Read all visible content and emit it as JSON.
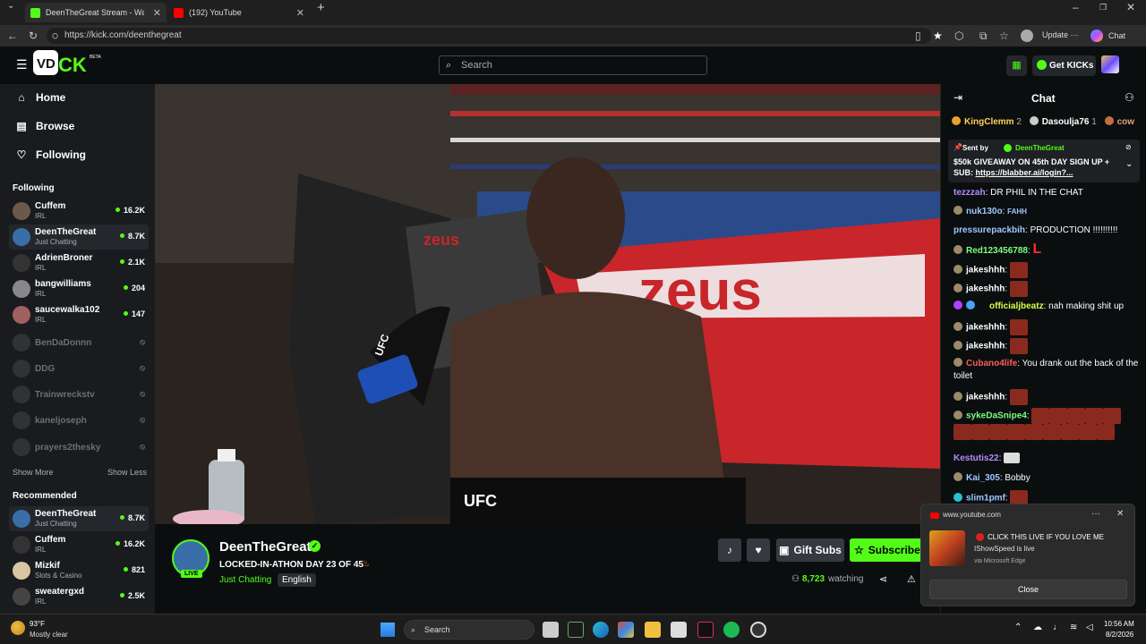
{
  "browser": {
    "tabs": [
      {
        "title": "DeenTheGreat Stream - Watc",
        "active": true
      },
      {
        "title": "(192) YouTube",
        "active": false
      }
    ],
    "url": "https://kick.com/deenthegreat",
    "update_label": "Update",
    "chat_label": "Chat"
  },
  "topnav": {
    "search_placeholder": "Search",
    "get_kicks_label": "Get KICKs"
  },
  "sidebar": {
    "nav": [
      {
        "label": "Home",
        "icon": "home-icon"
      },
      {
        "label": "Browse",
        "icon": "browse-icon"
      },
      {
        "label": "Following",
        "icon": "heart-icon"
      }
    ],
    "following_heading": "Following",
    "following": [
      {
        "name": "Cuffem",
        "category": "IRL",
        "viewers": "16.2K"
      },
      {
        "name": "DeenTheGreat",
        "category": "Just Chatting",
        "viewers": "8.7K"
      },
      {
        "name": "AdrienBroner",
        "category": "IRL",
        "viewers": "2.1K"
      },
      {
        "name": "bangwilliams",
        "category": "IRL",
        "viewers": "204"
      },
      {
        "name": "saucewalka102",
        "category": "IRL",
        "viewers": "147"
      }
    ],
    "offline": [
      "BenDaDonnn",
      "DDG",
      "Trainwreckstv",
      "kaneljoseph",
      "prayers2thesky"
    ],
    "show_more": "Show More",
    "show_less": "Show Less",
    "recommended_heading": "Recommended",
    "recommended": [
      {
        "name": "DeenTheGreat",
        "category": "Just Chatting",
        "viewers": "8.7K"
      },
      {
        "name": "Cuffem",
        "category": "IRL",
        "viewers": "16.2K"
      },
      {
        "name": "Mizkif",
        "category": "Slots & Casino",
        "viewers": "821"
      },
      {
        "name": "sweatergxd",
        "category": "IRL",
        "viewers": "2.5K"
      }
    ]
  },
  "stream": {
    "streamer": "DeenTheGreat",
    "live_badge": "LIVE",
    "title": "LOCKED-IN-ATHON DAY 23 OF 45",
    "category": "Just Chatting",
    "language": "English",
    "gift_subs": "Gift Subs",
    "subscribe": "Subscribe",
    "watching_count": "8,723",
    "watching_label": "watching",
    "video_text": {
      "ring_brand": "zeus",
      "shorts_brand": "UFC",
      "glove_brand": "UFC"
    }
  },
  "chat": {
    "title": "Chat",
    "leaders": [
      {
        "name": "KingClemm",
        "count": "2"
      },
      {
        "name": "Dasoulja76",
        "count": "1"
      },
      {
        "name": "cow",
        "count": ""
      }
    ],
    "pinned": {
      "sent_by_label": "Sent by",
      "sender": "DeenTheGreat",
      "text": "$50k GIVEAWAY ON 45th DAY SIGN UP + SUB:",
      "link": "https://blabber.ai/login?..."
    },
    "messages": [
      {
        "user": "tezzzah",
        "text": "DR PHIL IN THE CHAT",
        "color": "#b48cff"
      },
      {
        "user": "nuk130o",
        "text": "FAHH",
        "color": "#9ec8ff"
      },
      {
        "user": "pressurepackbih",
        "text": "PRODUCTION !!!!!!!!!!",
        "color": "#9ec8ff"
      },
      {
        "user": "Red123456788",
        "text": "L",
        "color": "#7cff7c"
      },
      {
        "user": "jakeshhh",
        "text": "",
        "color": "#ffffff"
      },
      {
        "user": "jakeshhh",
        "text": "",
        "color": "#ffffff"
      },
      {
        "user": "officialjbeatz",
        "text": "nah making shit up",
        "color": "#d6ff4a"
      },
      {
        "user": "jakeshhh",
        "text": "",
        "color": "#ffffff"
      },
      {
        "user": "jakeshhh",
        "text": "",
        "color": "#ffffff"
      },
      {
        "user": "Cubano4life",
        "text": "You drank out the back of the toilet",
        "color": "#ff5a5a"
      },
      {
        "user": "jakeshhh",
        "text": "",
        "color": "#ffffff"
      },
      {
        "user": "sykeDaSnipe4",
        "text": "",
        "color": "#7cff7c"
      },
      {
        "user": "Kestutis22",
        "text": "",
        "color": "#b48cff"
      },
      {
        "user": "Kai_305",
        "text": "Bobby",
        "color": "#9ec8ff"
      },
      {
        "user": "slim1pmf",
        "text": "",
        "color": "#9ec8ff"
      }
    ]
  },
  "notification": {
    "source": "www.youtube.com",
    "headline": "CLICK THIS LIVE IF YOU LOVE ME",
    "body": "IShowSpeed is live",
    "via": "via Microsoft Edge",
    "close_label": "Close"
  },
  "taskbar": {
    "temp": "93°F",
    "weather": "Mostly clear",
    "search_label": "Search",
    "time": "10:56 AM",
    "date": "8/2/2026"
  },
  "colors": {
    "kick_green": "#53fc18",
    "sidebar_bg": "#191b1f",
    "page_bg": "#0b0e0f"
  }
}
